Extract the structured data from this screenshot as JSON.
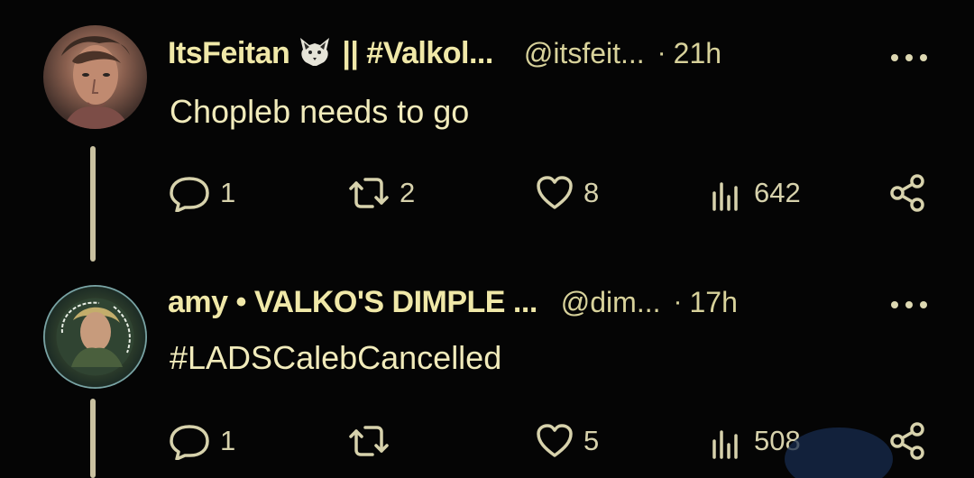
{
  "tweets": [
    {
      "display_name": "ItsFeitan",
      "display_name_suffix": "|| #Valkol...",
      "handle": "@itsfeit...",
      "separator": "·",
      "time": "21h",
      "text": "Chopleb needs to go",
      "replies": "1",
      "retweets": "2",
      "likes": "8",
      "views": "642"
    },
    {
      "display_name": "amy • VALKO'S DIMPLE ...",
      "display_name_suffix": "",
      "handle": "@dim...",
      "separator": "·",
      "time": "17h",
      "text": "#LADSCalebCancelled",
      "replies": "1",
      "retweets": "",
      "likes": "5",
      "views": "508"
    }
  ],
  "colors": {
    "background": "#050505",
    "primary_text": "#f1ebbb",
    "secondary_text": "#d8d29b",
    "icon": "#d7d2ac"
  },
  "icons": [
    "reply-icon",
    "retweet-icon",
    "like-icon",
    "views-icon",
    "share-icon",
    "more-icon"
  ]
}
